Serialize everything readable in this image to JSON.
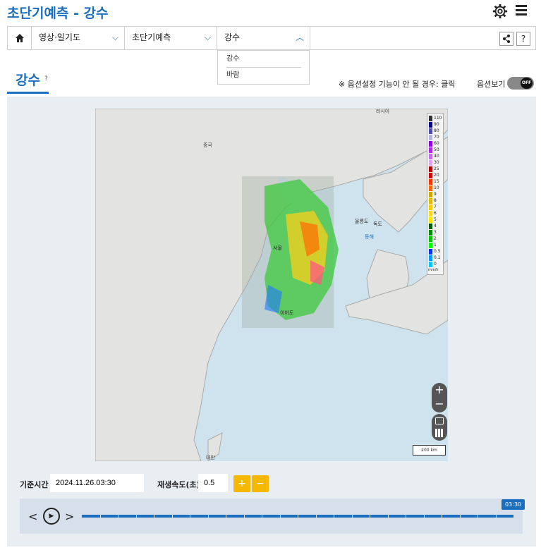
{
  "header": {
    "title": "초단기예측 - 강수",
    "settings_icon": "gear-icon",
    "menu_icon": "menu-icon"
  },
  "nav": {
    "home_icon": "home-icon",
    "menu1": "영상·일기도",
    "menu2": "초단기예측",
    "menu3": "강수",
    "share_icon": "share-icon",
    "help_label": "?"
  },
  "dropdown": {
    "items": [
      "강수",
      "바람"
    ]
  },
  "section": {
    "title": "강수",
    "help": "?",
    "note": "※ 옵션설정 기능이 안 될 경우: 클릭",
    "option_label": "옵션보기",
    "toggle_state": "OFF"
  },
  "map": {
    "labels": {
      "russia": "러시아",
      "china": "중국",
      "ulleungdo": "울릉도",
      "dokdo": "독도",
      "east_sea": "동해",
      "seoul": "서울",
      "ieodo": "이어도",
      "taipei": "대만"
    },
    "legend": {
      "values": [
        "110",
        "90",
        "80",
        "70",
        "60",
        "50",
        "40",
        "30",
        "25",
        "20",
        "15",
        "10",
        "9",
        "8",
        "7",
        "6",
        "5",
        "4",
        "3",
        "2",
        "1",
        "0.5",
        "0.1",
        "0"
      ],
      "unit": "mm/h",
      "colors": [
        "#333333",
        "#000390",
        "#4c4eb1",
        "#b3b4de",
        "#9200e4",
        "#ae2ce6",
        "#c969ee",
        "#e0a6f4",
        "#b40000",
        "#d20000",
        "#ff3300",
        "#ff6600",
        "#ccaa00",
        "#e0b900",
        "#f9cd00",
        "#ffdc1f",
        "#ffe600",
        "#005a00",
        "#008c00",
        "#00be00",
        "#00ff00",
        "#0033f5",
        "#0099ff",
        "#00c8ff"
      ]
    },
    "scale": "200 km",
    "zoom_in": "+",
    "zoom_out": "−"
  },
  "controls": {
    "base_time_label": "기준시간",
    "base_time_value": "2024.11.26.03:30",
    "speed_label": "재생속도(초)",
    "speed_value": "0.5",
    "plus": "+",
    "minus": "−"
  },
  "player": {
    "prev": "<",
    "next": ">",
    "current_time": "03:30",
    "progress": 1.0
  }
}
